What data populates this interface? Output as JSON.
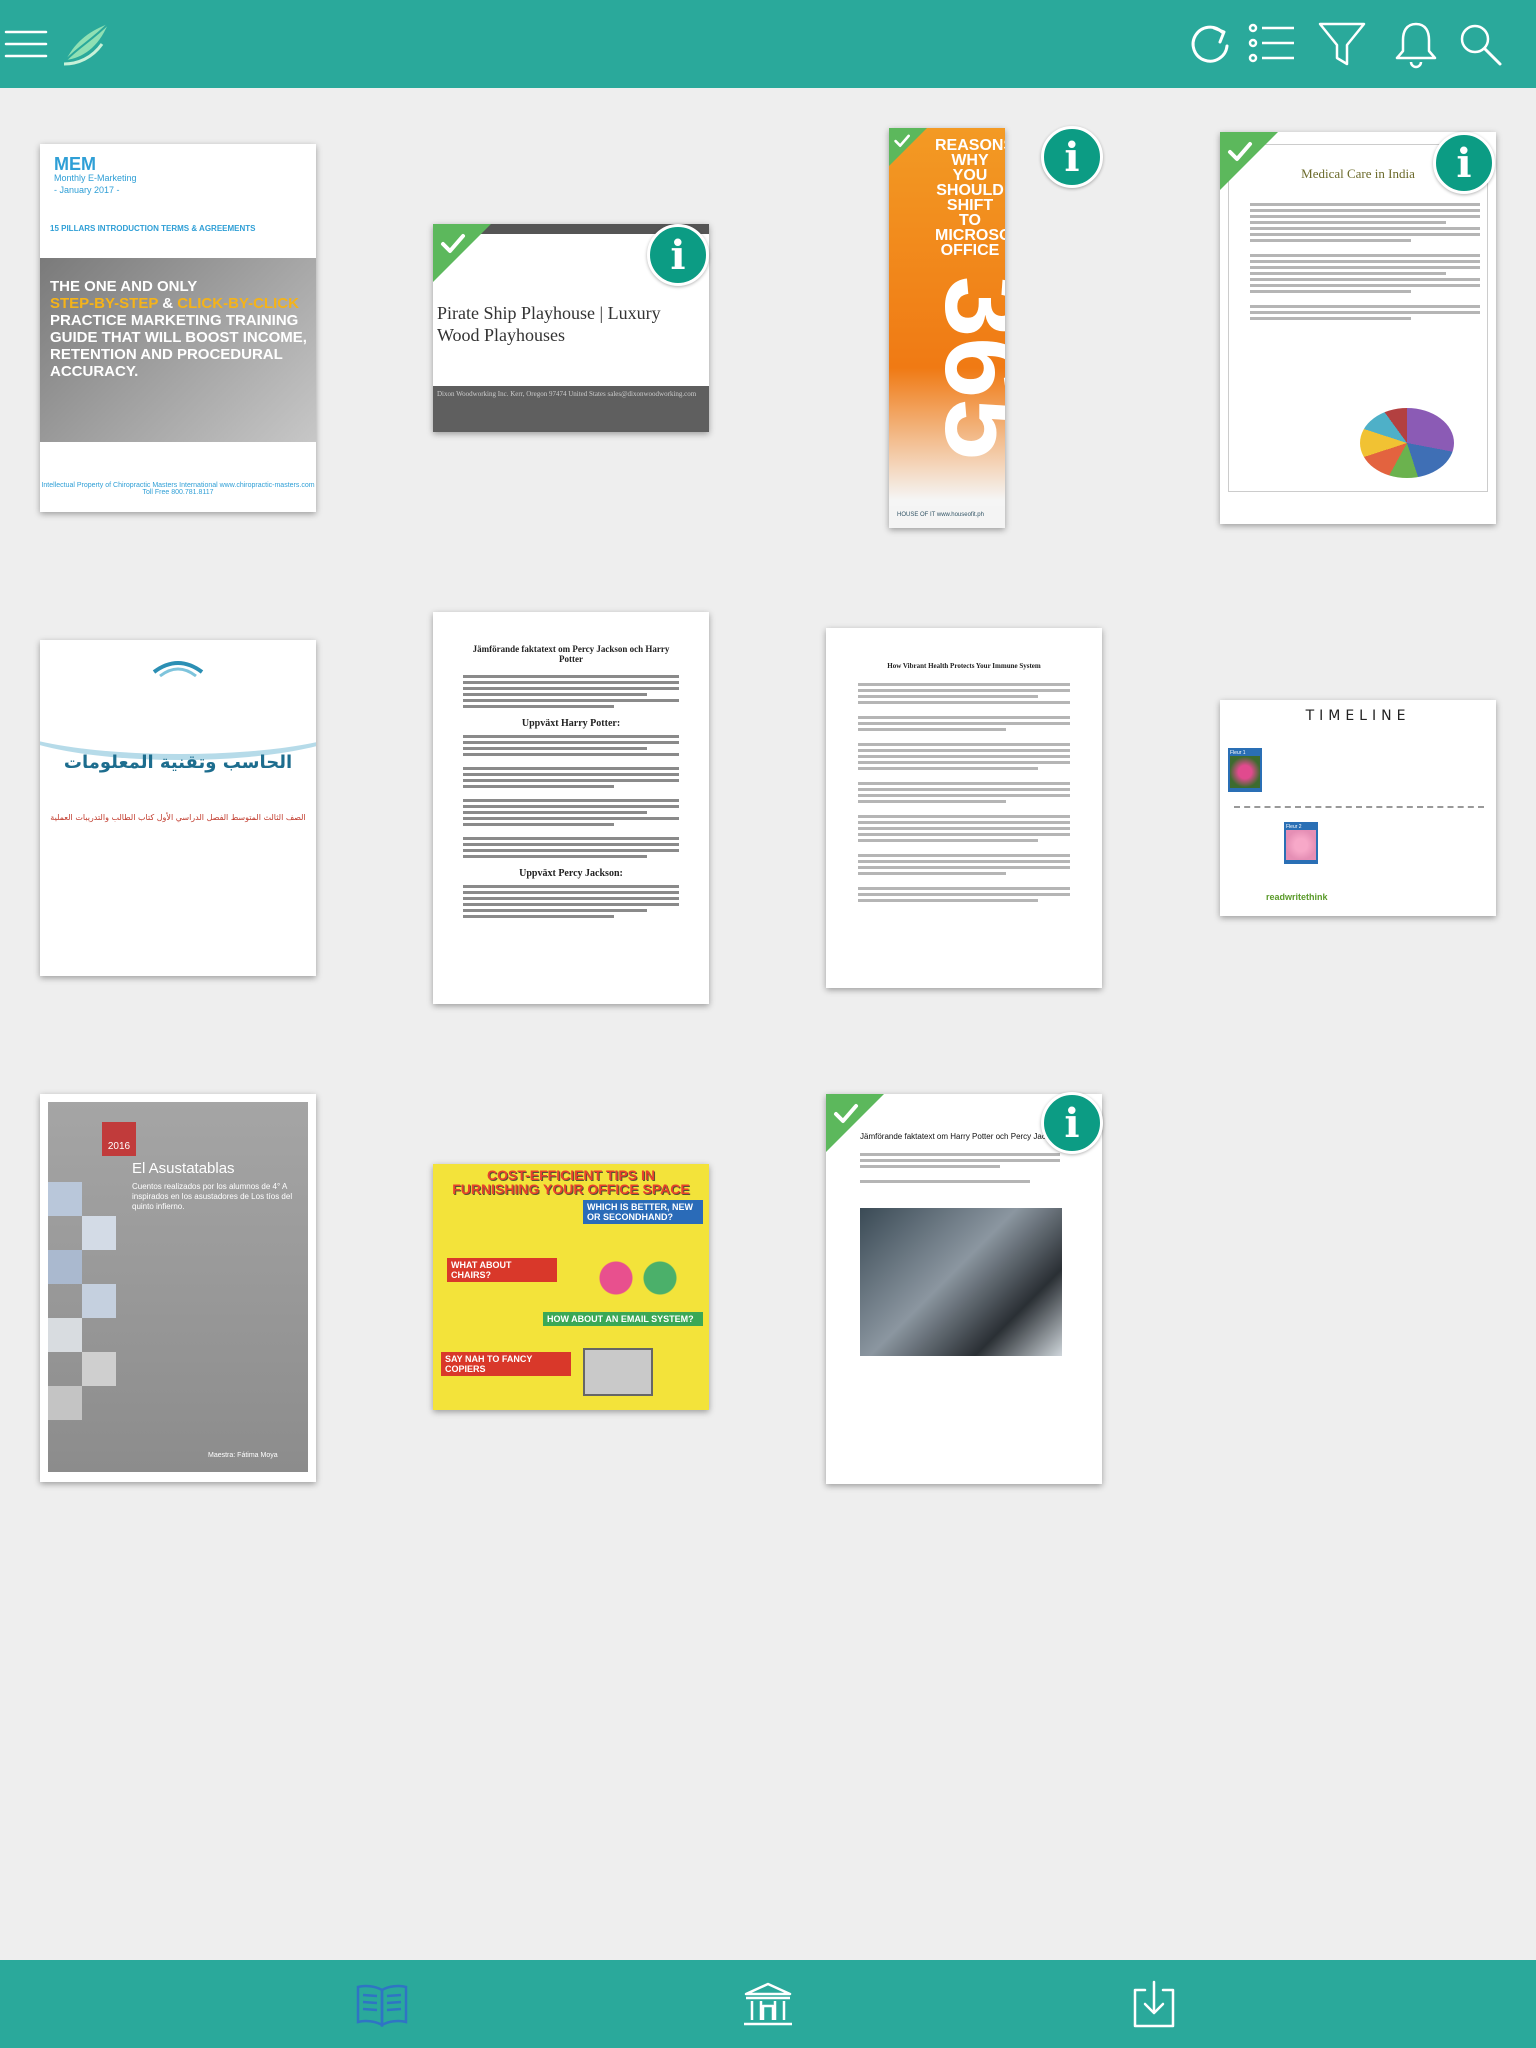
{
  "colors": {
    "bar": "#2aa99b",
    "accent": "#0c9c84",
    "check": "#5cb85c",
    "active_tab": "#2f74c4"
  },
  "top_bar": {
    "icons": [
      "menu-icon",
      "app-logo-leaf",
      "refresh-icon",
      "list-icon",
      "filter-icon",
      "bell-icon",
      "search-icon"
    ]
  },
  "books": [
    {
      "title": "MEM",
      "subtitle": "Monthly E-Marketing",
      "date": "- January 2017 -",
      "nav": "15 PILLARS    INTRODUCTION    TERMS & AGREEMENTS",
      "hero_line1": "THE ONE AND ONLY",
      "hero_hl1": "STEP-BY-STEP",
      "hero_amp": " & ",
      "hero_hl2": "CLICK-BY-CLICK",
      "hero_rest": "PRACTICE MARKETING TRAINING GUIDE THAT WILL BOOST INCOME, RETENTION AND PROCEDURAL ACCURACY.",
      "footer": "Intellectual Property of Chiropractic Masters International www.chiropractic-masters.com Toll Free 800.781.8117"
    },
    {
      "title": "Pirate Ship Playhouse | Luxury Wood Playhouses",
      "footer": "Dixon Woodworking Inc. Kerr, Oregon 97474 United States sales@dixonwoodworking.com",
      "downloaded": true
    },
    {
      "title": "REASONS WHY YOU SHOULD SHIFT TO MICROSOFT OFFICE",
      "number": "365",
      "footer": "HOUSE OF IT   www.houseofit.ph",
      "downloaded": true
    },
    {
      "title": "Medical Care in India",
      "downloaded": true
    },
    {
      "title": "الحاسب وتقنية المعلومات",
      "subtitle": "الصف الثالث المتوسط  الفصل الدراسي الأول  كتاب الطالب والتدريبات العملية"
    },
    {
      "title": "Jämförande faktatext om Percy Jackson och Harry Potter",
      "section1": "Uppväxt Harry Potter:",
      "section2": "Uppväxt Percy Jackson:"
    },
    {
      "title": "How Vibrant Health Protects Your Immune System"
    },
    {
      "title": "TIMELINE",
      "flag1": "Fleur 1",
      "flag2": "Fleur 2",
      "brand": "readwritethink"
    },
    {
      "year": "2016",
      "title": "El Asustatablas",
      "subtitle": "Cuentos realizados por los alumnos de 4° A inspirados en los asustadores de Los tíos del quinto infierno.",
      "author": "Maestra: Fátima Moya"
    },
    {
      "title": "COST-EFFICIENT TIPS IN FURNISHING YOUR OFFICE SPACE",
      "q1": "WHICH IS BETTER, NEW OR SECONDHAND?",
      "q2": "WHAT ABOUT CHAIRS?",
      "q3": "HOW ABOUT AN EMAIL SYSTEM?",
      "q4": "SAY NAH TO FANCY COPIERS"
    },
    {
      "title": "Jämförande faktatext om Harry Potter och Percy Jackson",
      "downloaded": true
    }
  ],
  "bottom_bar": {
    "tabs": [
      "reader-tab",
      "library-tab",
      "downloads-tab"
    ],
    "active": "reader-tab"
  }
}
